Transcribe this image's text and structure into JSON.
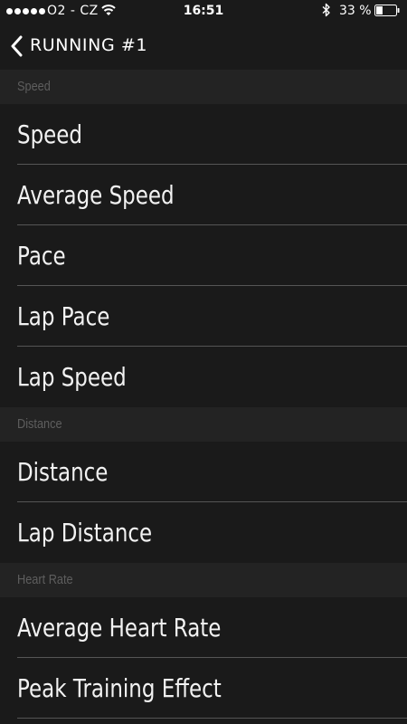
{
  "status_bar": {
    "carrier": "O2 - CZ",
    "time": "16:51",
    "battery_percent": "33 %",
    "battery_level": 0.33,
    "signal_bars": 5,
    "icons": [
      "signal-dots-icon",
      "wifi-icon",
      "bluetooth-icon",
      "battery-icon"
    ]
  },
  "nav": {
    "back_icon": "chevron-left-icon",
    "title": "RUNNING #1"
  },
  "sections": [
    {
      "header": "Speed",
      "items": [
        "Speed",
        "Average Speed",
        "Pace",
        "Lap Pace",
        "Lap Speed"
      ]
    },
    {
      "header": "Distance",
      "items": [
        "Distance",
        "Lap Distance"
      ]
    },
    {
      "header": "Heart Rate",
      "items": [
        "Average Heart Rate",
        "Peak Training Effect"
      ]
    }
  ],
  "colors": {
    "background": "#1a1a1a",
    "section_header_bg": "#232323",
    "section_header_text": "#5e5e5e",
    "item_text": "#f2f2f2",
    "divider": "#555555"
  }
}
